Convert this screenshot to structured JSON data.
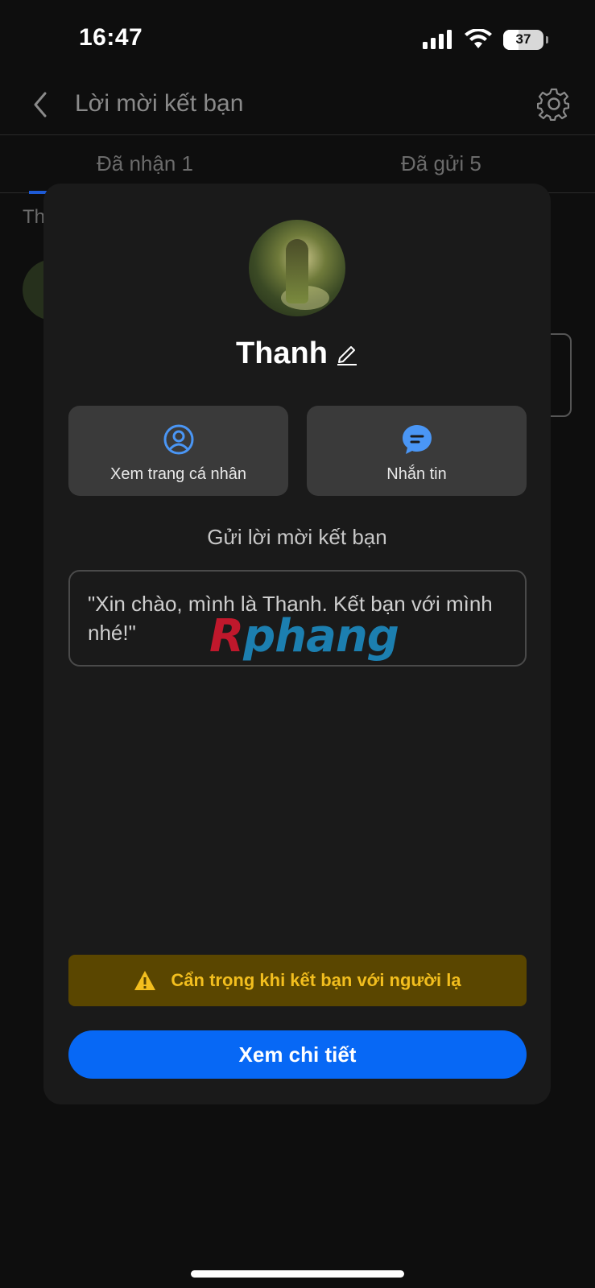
{
  "status_bar": {
    "time": "16:47",
    "battery": "37",
    "battery_level": 0.37
  },
  "nav": {
    "title": "Lời mời kết bạn",
    "back_icon": "chevron-left-icon",
    "settings_icon": "gear-icon"
  },
  "tabs": [
    {
      "label": "Đã nhận  1",
      "active": true
    },
    {
      "label": "Đã gửi  5",
      "active": false
    }
  ],
  "background": {
    "section_hint": "Th"
  },
  "modal": {
    "name": "Thanh",
    "actions": {
      "profile_label": "Xem trang cá nhân",
      "message_label": "Nhắn tin"
    },
    "invite_heading": "Gửi lời mời kết bạn",
    "invite_message": "\"Xin chào, mình là Thanh. Kết bạn với mình nhé!\"",
    "watermark": {
      "part1": "R",
      "part2": "phang"
    },
    "warning": "Cẩn trọng khi kết bạn với người lạ",
    "detail_button": "Xem chi tiết"
  },
  "colors": {
    "accent": "#0768f5",
    "warning_bg": "#5a4600",
    "warning_text": "#f2be1e",
    "modal_bg": "#1a1a1a"
  }
}
